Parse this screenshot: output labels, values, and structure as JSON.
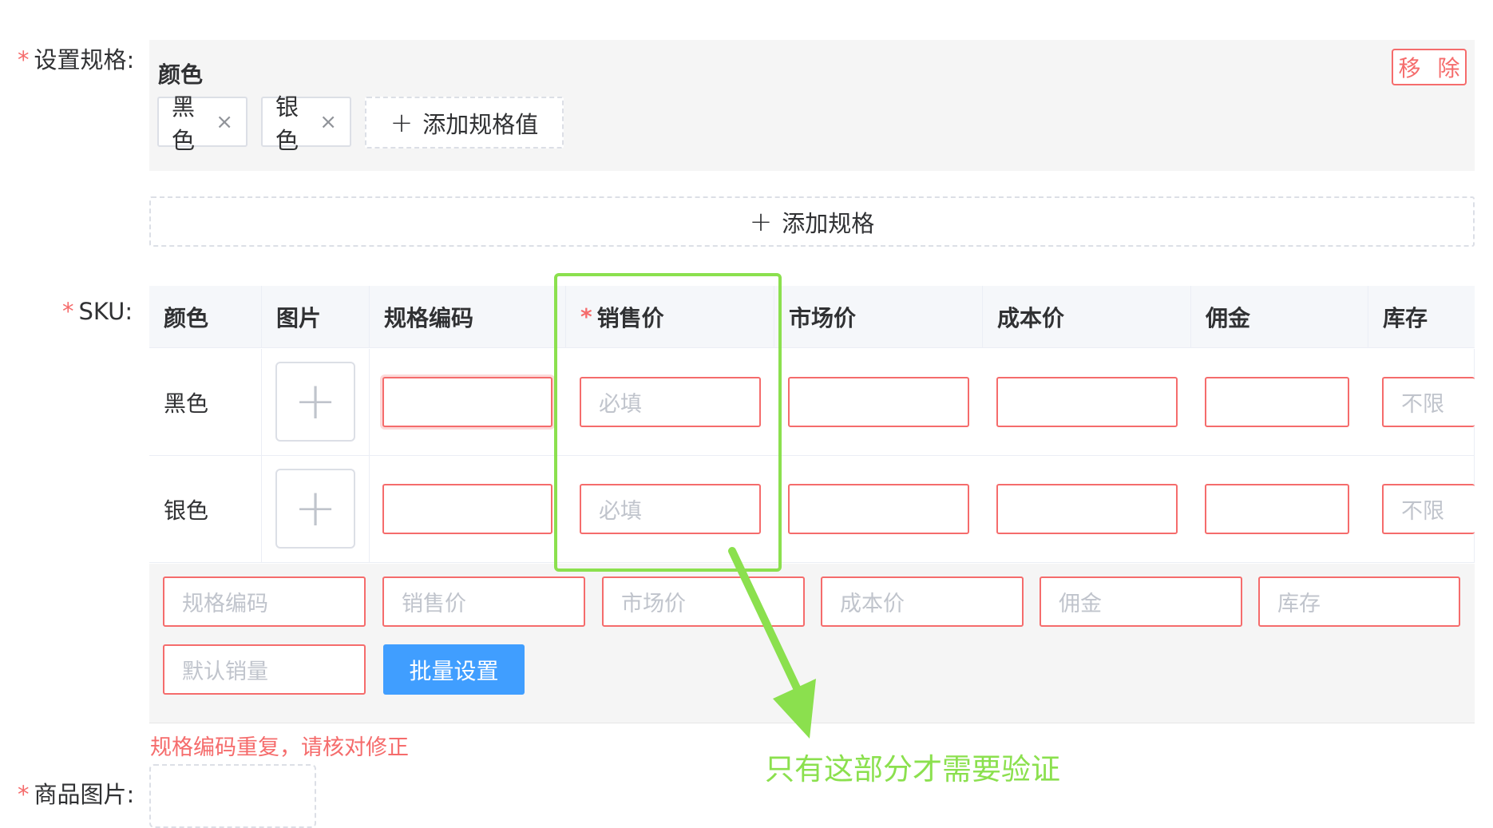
{
  "labels": {
    "spec": "设置规格:",
    "sku": "SKU:",
    "product_images": "商品图片:",
    "required_mark": "*"
  },
  "spec": {
    "name": "颜色",
    "remove_label": "移 除",
    "values": [
      {
        "label": "黑色",
        "close": "×"
      },
      {
        "label": "银色",
        "close": "×"
      }
    ],
    "add_value_label": "添加规格值",
    "add_spec_label": "添加规格",
    "plus_icon": "+"
  },
  "table": {
    "headers": [
      "颜色",
      "图片",
      "规格编码",
      "销售价",
      "市场价",
      "成本价",
      "佣金",
      "库存"
    ],
    "required_header_index": 3,
    "rows": [
      {
        "color": "黑色",
        "price_placeholder": "必填",
        "stock_placeholder": "不限"
      },
      {
        "color": "银色",
        "price_placeholder": "必填",
        "stock_placeholder": "不限"
      }
    ],
    "upload_icon": "+"
  },
  "batch": {
    "placeholders": [
      "规格编码",
      "销售价",
      "市场价",
      "成本价",
      "佣金",
      "库存",
      "默认销量"
    ],
    "button_label": "批量设置"
  },
  "error_message": "规格编码重复，请核对修正",
  "annotation": {
    "text": "只有这部分才需要验证",
    "color": "#8be04e"
  },
  "colors": {
    "error": "#f56c6c",
    "primary": "#409eff",
    "highlight": "#8be04e"
  }
}
